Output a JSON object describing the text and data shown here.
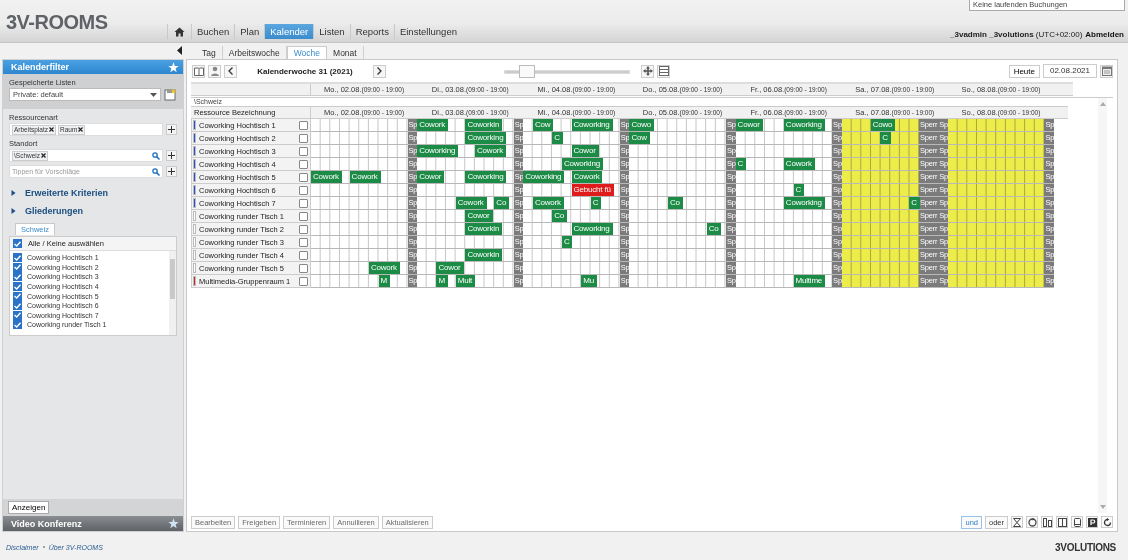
{
  "header": {
    "logo": "3V-ROOMS",
    "status": "Keine laufenden Buchungen",
    "user": "**_3vadmin _3volutions** (UTC+02:00)",
    "logout": "Abmelden"
  },
  "nav": [
    {
      "label": "Buchen",
      "selected": false
    },
    {
      "label": "Plan",
      "selected": false
    },
    {
      "label": "Kalender",
      "selected": true
    },
    {
      "label": "Listen",
      "selected": false
    },
    {
      "label": "Reports",
      "selected": false
    },
    {
      "label": "Einstellungen",
      "selected": false
    }
  ],
  "view_tabs": [
    {
      "label": "Tag",
      "selected": false
    },
    {
      "label": "Arbeitswoche",
      "selected": false
    },
    {
      "label": "Woche",
      "selected": true
    },
    {
      "label": "Monat",
      "selected": false
    }
  ],
  "sidebar": {
    "title": "Kalenderfilter",
    "saved_lists_label": "Gespeicherte Listen",
    "saved_list": "Private: default",
    "resource_type_label": "Ressourcenart",
    "resource_types": [
      "Arbeitsplatz",
      "Raum"
    ],
    "location_label": "Standort",
    "locations": [
      "\\Schweiz"
    ],
    "suggest_placeholder": "Tippen für Vorschläge",
    "sections": [
      {
        "label": "Erweiterte Kriterien",
        "expanded": false
      },
      {
        "label": "Gliederungen",
        "expanded": false
      }
    ],
    "group_tab": "Schweiz",
    "select_all": {
      "label": "Alle / Keine auswählen",
      "checked": true
    },
    "resources": [
      {
        "label": "Coworking Hochtisch 1",
        "checked": true
      },
      {
        "label": "Coworking Hochtisch 2",
        "checked": true
      },
      {
        "label": "Coworking Hochtisch 3",
        "checked": true
      },
      {
        "label": "Coworking Hochtisch 4",
        "checked": true
      },
      {
        "label": "Coworking Hochtisch 5",
        "checked": true
      },
      {
        "label": "Coworking Hochtisch 6",
        "checked": true
      },
      {
        "label": "Coworking Hochtisch 7",
        "checked": true
      },
      {
        "label": "Coworking runder Tisch 1",
        "checked": true
      }
    ],
    "show_button": "Anzeigen",
    "video_title": "Video Konferenz"
  },
  "toolbar": {
    "week": "Kalenderwoche 31 (2021)",
    "zoom": {
      "level": 0.12
    },
    "today": "Heute",
    "date": "02.08.2021"
  },
  "scale": [
    {
      "label": "Mo., 02.08.",
      "hours": "(09:00 - 19:00)"
    },
    {
      "label": "Di., 03.08.",
      "hours": "(09:00 - 19:00)"
    },
    {
      "label": "Mi., 04.08.",
      "hours": "(09:00 - 19:00)"
    },
    {
      "label": "Do., 05.08.",
      "hours": "(09:00 - 19:00)"
    },
    {
      "label": "Fr., 06.08.",
      "hours": "(09:00 - 19:00)"
    },
    {
      "label": "Sa., 07.08.",
      "hours": "(09:00 - 19:00)"
    },
    {
      "label": "So., 08.08.",
      "hours": "(09:00 - 19:00)"
    }
  ],
  "group": "\\Schweiz",
  "resource_heading": "Ressource Bezeichnung",
  "days": [
    {
      "label": "Mo., 02.08.",
      "hours": "(09:00 - 19:00)",
      "weekend": false,
      "kind": "open"
    },
    {
      "label": "Di., 03.08.",
      "hours": "(09:00 - 19:00)",
      "weekend": false,
      "kind": "open"
    },
    {
      "label": "Mi., 04.08.",
      "hours": "(09:00 - 19:00)",
      "weekend": false,
      "kind": "open"
    },
    {
      "label": "Do., 05.08.",
      "hours": "(09:00 - 19:00)",
      "weekend": false,
      "kind": "open"
    },
    {
      "label": "Fr., 06.08.",
      "hours": "(09:00 - 19:00)",
      "weekend": false,
      "kind": "open"
    },
    {
      "label": "Sa., 07.08.",
      "hours": "(09:00 - 19:00)",
      "weekend": true,
      "kind": "closing"
    },
    {
      "label": "So., 08.08.",
      "hours": "(09:00 - 19:00)",
      "weekend": true,
      "kind": "open"
    }
  ],
  "rows": [
    {
      "name": "Coworking Hochtisch 1",
      "color": "#2a4fd6",
      "checked": false,
      "days": [
        {
          "block": "Sp"
        },
        {
          "block": "Sp",
          "cells": [
            {
              "label": "Cowork",
              "kind": "booking"
            },
            null,
            null,
            null,
            null,
            {
              "label": "Coworkin",
              "kind": "booking"
            }
          ]
        },
        {
          "block": "Sp",
          "cells": [
            null,
            {
              "label": "Cow",
              "kind": "booking"
            },
            null,
            null,
            null,
            {
              "label": "Coworking",
              "kind": "booking"
            }
          ]
        },
        {
          "block": "Sp",
          "cells": [
            {
              "label": "Cowo",
              "kind": "booking"
            }
          ]
        },
        {
          "block": "Sp",
          "cells": [
            {
              "label": "Cowor",
              "kind": "booking"
            },
            null,
            null,
            null,
            null,
            {
              "label": "Coworking",
              "kind": "booking"
            }
          ]
        },
        {
          "block": "Sperr Sp",
          "cells": [
            null,
            null,
            null,
            {
              "label": "Cowo",
              "kind": "booking"
            }
          ]
        },
        {
          "block": "Sp"
        }
      ]
    },
    {
      "name": "Coworking Hochtisch 2",
      "color": "#2a4fd6",
      "checked": false,
      "days": [
        {
          "block": "Sp"
        },
        {
          "block": "Sp",
          "cells": [
            null,
            null,
            null,
            null,
            null,
            {
              "label": "Coworking",
              "kind": "booking"
            }
          ]
        },
        {
          "block": "Sp",
          "cells": [
            null,
            null,
            null,
            {
              "label": "C",
              "kind": "booking"
            }
          ]
        },
        {
          "block": "Sp",
          "cells": [
            {
              "label": "Cow",
              "kind": "booking"
            }
          ]
        },
        {
          "block": "Sp"
        },
        {
          "block": "Sperr Sp",
          "cells": [
            null,
            null,
            null,
            null,
            {
              "label": "C",
              "kind": "booking"
            }
          ]
        },
        {
          "block": "Sp"
        }
      ]
    },
    {
      "name": "Coworking Hochtisch 3",
      "color": "#2a4fd6",
      "checked": false,
      "days": [
        {
          "block": "Sp"
        },
        {
          "block": "Sp",
          "cells": [
            {
              "label": "Coworking",
              "kind": "booking"
            },
            null,
            null,
            null,
            null,
            null,
            {
              "label": "Cowork",
              "kind": "booking"
            }
          ]
        },
        {
          "block": "Sp",
          "cells": [
            null,
            null,
            null,
            null,
            null,
            {
              "label": "Cowor",
              "kind": "booking"
            }
          ]
        },
        {
          "block": "Sp"
        },
        {
          "block": "Sp"
        },
        {
          "block": "Sperr Sp"
        },
        {
          "block": "Sp"
        }
      ]
    },
    {
      "name": "Coworking Hochtisch 4",
      "color": "#2a4fd6",
      "checked": false,
      "days": [
        {
          "block": "Sp"
        },
        {
          "block": "Sp"
        },
        {
          "block": "Sp",
          "cells": [
            null,
            null,
            null,
            null,
            {
              "label": "Coworking",
              "kind": "booking"
            }
          ]
        },
        {
          "block": "Sp"
        },
        {
          "block": "Sp",
          "cells": [
            {
              "label": "C",
              "kind": "booking"
            },
            null,
            null,
            null,
            null,
            {
              "label": "Cowork",
              "kind": "booking"
            }
          ]
        },
        {
          "block": "Sperr Sp"
        },
        {
          "block": "Sp"
        }
      ]
    },
    {
      "name": "Coworking Hochtisch 5",
      "color": "#2a4fd6",
      "checked": false,
      "days": [
        {
          "block": "Sp",
          "cells": [
            {
              "label": "Cowork",
              "kind": "booking"
            },
            null,
            null,
            null,
            {
              "label": "Cowork",
              "kind": "booking"
            }
          ]
        },
        {
          "block": "Sp",
          "cells": [
            {
              "label": "Cowor",
              "kind": "booking"
            },
            null,
            null,
            null,
            null,
            {
              "label": "Coworking",
              "kind": "booking"
            }
          ]
        },
        {
          "block": "Sp",
          "cells": [
            {
              "label": "Coworking",
              "kind": "booking"
            },
            null,
            null,
            null,
            null,
            {
              "label": "Cowork",
              "kind": "booking"
            }
          ]
        },
        {
          "block": "Sp"
        },
        {
          "block": "Sp"
        },
        {
          "block": "Sperr Sp"
        },
        {
          "block": "Sp"
        }
      ]
    },
    {
      "name": "Coworking Hochtisch 6",
      "color": "#2a4fd6",
      "checked": false,
      "days": [
        {
          "block": "Sp"
        },
        {
          "block": "Sp"
        },
        {
          "block": "Sp",
          "cells": [
            null,
            null,
            null,
            null,
            null,
            {
              "label": "Gebucht fü",
              "kind": "conflict"
            }
          ]
        },
        {
          "block": "Sp"
        },
        {
          "block": "Sp",
          "cells": [
            null,
            null,
            null,
            null,
            null,
            null,
            {
              "label": "C",
              "kind": "booking"
            }
          ]
        },
        {
          "block": "Sperr Sp"
        },
        {
          "block": "Sp"
        }
      ]
    },
    {
      "name": "Coworking Hochtisch 7",
      "color": "#2a4fd6",
      "checked": false,
      "days": [
        {
          "block": "Sp"
        },
        {
          "block": "Sp",
          "cells": [
            null,
            null,
            null,
            null,
            {
              "label": "Cowork",
              "kind": "booking"
            },
            null,
            null,
            null,
            {
              "label": "Co",
              "kind": "booking"
            }
          ]
        },
        {
          "block": "Sp",
          "cells": [
            null,
            {
              "label": "Cowork",
              "kind": "booking"
            },
            null,
            null,
            null,
            null,
            null,
            {
              "label": "C",
              "kind": "booking"
            }
          ]
        },
        {
          "block": "Sp",
          "cells": [
            null,
            null,
            null,
            null,
            {
              "label": "Co",
              "kind": "booking"
            }
          ]
        },
        {
          "block": "Sp",
          "cells": [
            null,
            null,
            null,
            null,
            null,
            {
              "label": "Coworking",
              "kind": "booking"
            }
          ]
        },
        {
          "block": "Sperr Sp",
          "cells": [
            null,
            null,
            null,
            null,
            null,
            null,
            null,
            {
              "label": "C",
              "kind": "booking"
            }
          ]
        },
        {
          "block": "Sp"
        }
      ]
    },
    {
      "name": "Coworking runder Tisch 1",
      "color": "#ffffff",
      "checked": false,
      "days": [
        {
          "block": "Sp"
        },
        {
          "block": "Sp",
          "cells": [
            null,
            null,
            null,
            null,
            null,
            {
              "label": "Cowor",
              "kind": "booking"
            }
          ]
        },
        {
          "block": "Sp",
          "cells": [
            null,
            null,
            null,
            {
              "label": "Co",
              "kind": "booking"
            }
          ]
        },
        {
          "block": "Sp"
        },
        {
          "block": "Sp"
        },
        {
          "block": "Sperr Sp"
        },
        {
          "block": "Sp"
        }
      ]
    },
    {
      "name": "Coworking runder Tisch 2",
      "color": "#ffffff",
      "checked": false,
      "days": [
        {
          "block": "Sp"
        },
        {
          "block": "Sp",
          "cells": [
            null,
            null,
            null,
            null,
            null,
            {
              "label": "Coworkin",
              "kind": "booking"
            }
          ]
        },
        {
          "block": "Sp",
          "cells": [
            null,
            null,
            null,
            null,
            null,
            {
              "label": "Coworking",
              "kind": "booking"
            }
          ]
        },
        {
          "block": "Sp",
          "cells": [
            null,
            null,
            null,
            null,
            null,
            null,
            null,
            null,
            {
              "label": "Co",
              "kind": "booking"
            }
          ]
        },
        {
          "block": "Sp"
        },
        {
          "block": "Sperr Sp"
        },
        {
          "block": "Sp"
        }
      ]
    },
    {
      "name": "Coworking runder Tisch 3",
      "color": "#ffffff",
      "checked": false,
      "days": [
        {
          "block": "Sp"
        },
        {
          "block": "Sp"
        },
        {
          "block": "Sp",
          "cells": [
            null,
            null,
            null,
            null,
            {
              "label": "C",
              "kind": "booking"
            }
          ]
        },
        {
          "block": "Sp"
        },
        {
          "block": "Sp"
        },
        {
          "block": "Sperr Sp"
        },
        {
          "block": "Sp"
        }
      ]
    },
    {
      "name": "Coworking runder Tisch 4",
      "color": "#ffffff",
      "checked": false,
      "days": [
        {
          "block": "Sp"
        },
        {
          "block": "Sp",
          "cells": [
            null,
            null,
            null,
            null,
            null,
            {
              "label": "Coworkin",
              "kind": "booking"
            }
          ]
        },
        {
          "block": "Sp"
        },
        {
          "block": "Sp"
        },
        {
          "block": "Sp"
        },
        {
          "block": "Sperr Sp"
        },
        {
          "block": "Sp"
        }
      ]
    },
    {
      "name": "Coworking runder Tisch 5",
      "color": "#ffffff",
      "checked": false,
      "days": [
        {
          "block": "Sp",
          "cells": [
            null,
            null,
            null,
            null,
            null,
            null,
            {
              "label": "Cowork",
              "kind": "booking"
            }
          ]
        },
        {
          "block": "Sp",
          "cells": [
            null,
            null,
            {
              "label": "Cowor",
              "kind": "booking"
            }
          ]
        },
        {
          "block": "Sp"
        },
        {
          "block": "Sp"
        },
        {
          "block": "Sp"
        },
        {
          "block": "Sperr Sp"
        },
        {
          "block": "Sp"
        }
      ]
    },
    {
      "name": "Multimedia-Gruppenraum 1",
      "color": "#d42323",
      "checked": false,
      "days": [
        {
          "block": "Sp",
          "cells": [
            null,
            null,
            null,
            null,
            null,
            null,
            null,
            {
              "label": "M",
              "kind": "booking"
            }
          ]
        },
        {
          "block": "Sp",
          "cells": [
            null,
            null,
            {
              "label": "M",
              "kind": "booking"
            },
            null,
            {
              "label": "Mult",
              "kind": "booking"
            }
          ]
        },
        {
          "block": "Sp",
          "cells": [
            null,
            null,
            null,
            null,
            null,
            null,
            {
              "label": "Mu",
              "kind": "booking"
            }
          ]
        },
        {
          "block": "Sp"
        },
        {
          "block": "Sp",
          "cells": [
            null,
            null,
            null,
            null,
            null,
            null,
            {
              "label": "Multime",
              "kind": "booking"
            }
          ]
        },
        {
          "block": "Sperr Sp"
        },
        {
          "block": "Sp"
        }
      ]
    }
  ],
  "actions": [
    {
      "label": "Bearbeiten",
      "disabled": true
    },
    {
      "label": "Freigeben",
      "disabled": true
    },
    {
      "label": "Terminieren",
      "disabled": true
    },
    {
      "label": "Annullieren",
      "disabled": true
    },
    {
      "label": "Aktualisieren",
      "disabled": true
    }
  ],
  "logic": [
    {
      "label": "und",
      "selected": true
    },
    {
      "label": "oder",
      "selected": false
    }
  ],
  "footer": {
    "links": [
      "Disclaimer",
      "Über 3V-ROOMS"
    ],
    "brand": "3VOLUTIONS"
  }
}
